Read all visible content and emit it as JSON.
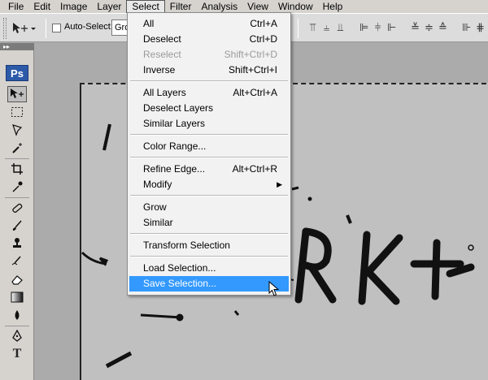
{
  "menubar": {
    "items": [
      "File",
      "Edit",
      "Image",
      "Layer",
      "Select",
      "Filter",
      "Analysis",
      "View",
      "Window",
      "Help"
    ],
    "active": "Select"
  },
  "options": {
    "autoselect_label": "Auto-Select:",
    "group_value": "Group"
  },
  "tools": {
    "logo": "Ps"
  },
  "select_menu": {
    "all": {
      "label": "All",
      "shortcut": "Ctrl+A"
    },
    "deselect": {
      "label": "Deselect",
      "shortcut": "Ctrl+D"
    },
    "reselect": {
      "label": "Reselect",
      "shortcut": "Shift+Ctrl+D"
    },
    "inverse": {
      "label": "Inverse",
      "shortcut": "Shift+Ctrl+I"
    },
    "all_layers": {
      "label": "All Layers",
      "shortcut": "Alt+Ctrl+A"
    },
    "deselect_layers": {
      "label": "Deselect Layers"
    },
    "similar_layers": {
      "label": "Similar Layers"
    },
    "color_range": {
      "label": "Color Range..."
    },
    "refine_edge": {
      "label": "Refine Edge...",
      "shortcut": "Alt+Ctrl+R"
    },
    "modify": {
      "label": "Modify"
    },
    "grow": {
      "label": "Grow"
    },
    "similar": {
      "label": "Similar"
    },
    "transform_selection": {
      "label": "Transform Selection"
    },
    "load_selection": {
      "label": "Load Selection..."
    },
    "save_selection": {
      "label": "Save Selection..."
    }
  },
  "colors": {
    "highlight": "#3399ff",
    "logo_blue": "#2d5aa8",
    "canvas": "#c0c0c0"
  }
}
